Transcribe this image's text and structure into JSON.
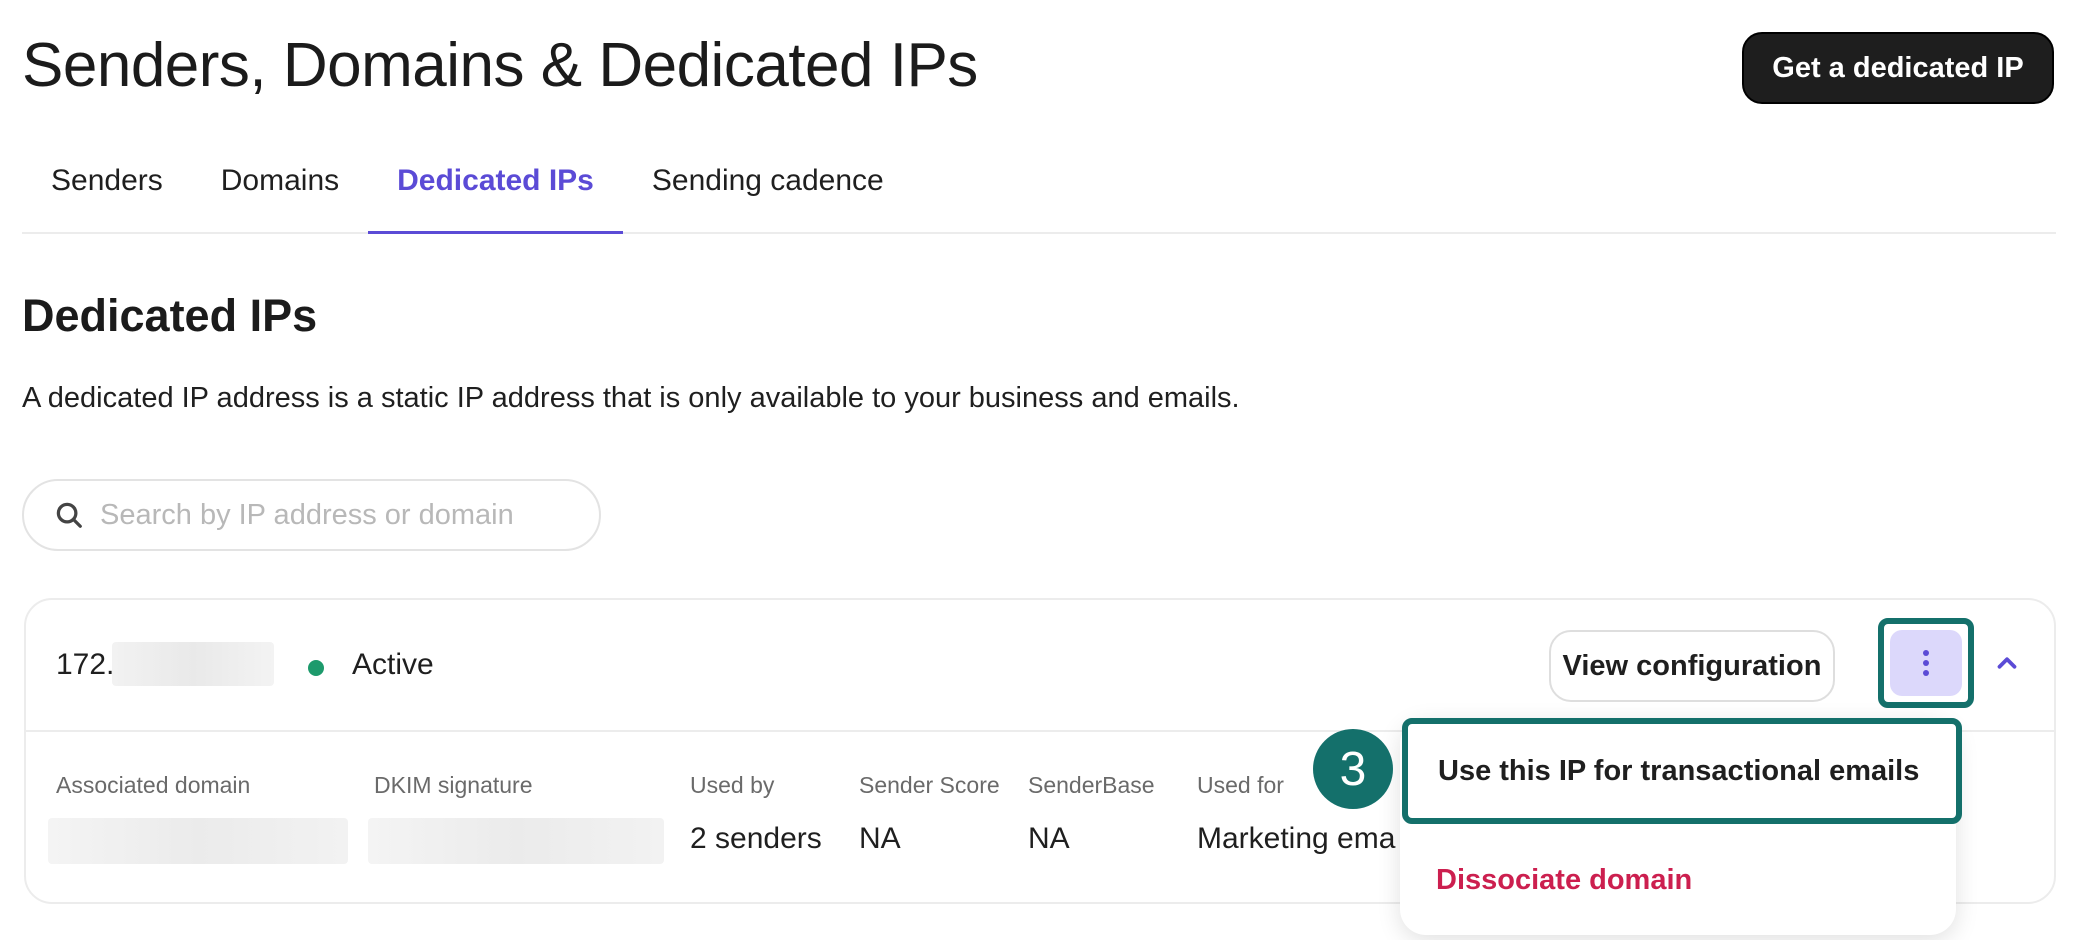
{
  "header": {
    "title": "Senders, Domains & Dedicated IPs",
    "primary_button": "Get a dedicated IP"
  },
  "tabs": [
    {
      "label": "Senders",
      "active": false
    },
    {
      "label": "Domains",
      "active": false
    },
    {
      "label": "Dedicated IPs",
      "active": true
    },
    {
      "label": "Sending cadence",
      "active": false
    }
  ],
  "section": {
    "title": "Dedicated IPs",
    "description": "A dedicated IP address is a static IP address that is only available to your business and emails."
  },
  "search": {
    "placeholder": "Search by IP address or domain",
    "icon": "search-icon"
  },
  "ip_card": {
    "ip_prefix": "172.",
    "status": "Active",
    "status_color": "#1d9a6c",
    "view_button": "View configuration",
    "columns": [
      {
        "label": "Associated domain",
        "value": ""
      },
      {
        "label": "DKIM signature",
        "value": ""
      },
      {
        "label": "Used by",
        "value": "2 senders"
      },
      {
        "label": "Sender Score",
        "value": "NA"
      },
      {
        "label": "SenderBase",
        "value": "NA"
      },
      {
        "label": "Used for",
        "value": "Marketing ema"
      }
    ]
  },
  "context_menu": {
    "items": [
      {
        "label": "Use this IP for transactional emails",
        "highlighted": true
      },
      {
        "label": "Dissociate domain",
        "danger": true
      }
    ]
  },
  "annotation": {
    "step": "3"
  },
  "colors": {
    "accent": "#5b4bd6",
    "highlight": "#14706b",
    "danger": "#cc1f4f",
    "kebab_bg": "#dcd8fb"
  }
}
